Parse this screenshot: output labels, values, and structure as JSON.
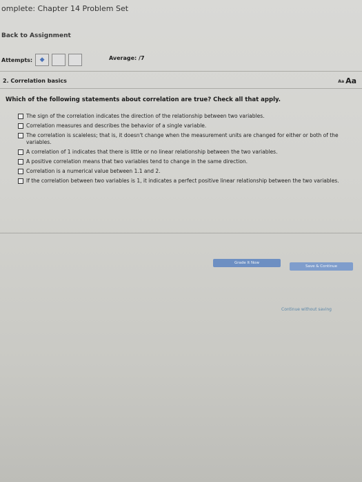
{
  "header": {
    "title": "omplete: Chapter 14 Problem Set"
  },
  "nav": {
    "back_label": "Back to Assignment"
  },
  "attempts": {
    "label": "Attempts:",
    "first_box_symbol": "◆"
  },
  "average": {
    "label": "Average:",
    "value": "/7"
  },
  "question": {
    "title": "2. Correlation basics",
    "font_small": "Aa",
    "font_large": "Aa",
    "prompt": "Which of the following statements about correlation are true? Check all that apply.",
    "options": [
      "The sign of the correlation indicates the direction of the relationship between two variables.",
      "Correlation measures and describes the behavior of a single variable.",
      "The correlation is scaleless; that is, it doesn't change when the measurement units are changed for either or both of the variables.",
      "A correlation of 1 indicates that there is little or no linear relationship between the two variables.",
      "A positive correlation means that two variables tend to change in the same direction.",
      "Correlation is a numerical value between 1.1 and 2.",
      "If the correlation between two variables is 1, it indicates a perfect positive linear relationship between the two variables."
    ]
  },
  "footer": {
    "grade_button": "Grade It Now",
    "save_button": "Save & Continue",
    "continue_link": "Continue without saving"
  }
}
